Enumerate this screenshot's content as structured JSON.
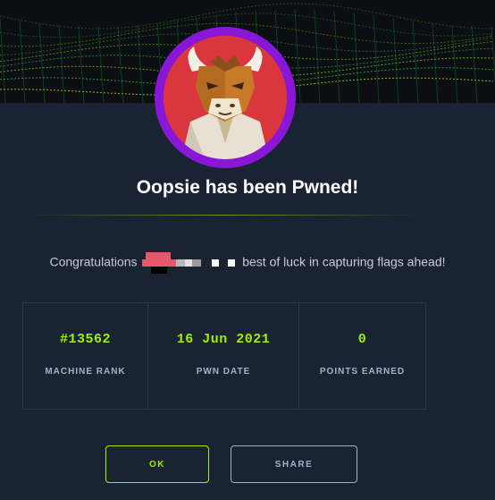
{
  "dialog": {
    "title": "Oopsie has been Pwned!",
    "message_prefix": "Congratulations",
    "message_suffix": "best of luck in capturing flags ahead!"
  },
  "stats": [
    {
      "value": "#13562",
      "label": "MACHINE RANK"
    },
    {
      "value": "16 Jun 2021",
      "label": "PWN DATE"
    },
    {
      "value": "0",
      "label": "POINTS EARNED"
    }
  ],
  "buttons": {
    "ok_label": "OK",
    "share_label": "SHARE"
  },
  "colors": {
    "accent_green": "#9fef00",
    "avatar_ring": "#8a16d8",
    "background": "#1a2332"
  },
  "icons": [
    "machine-avatar-icon"
  ]
}
